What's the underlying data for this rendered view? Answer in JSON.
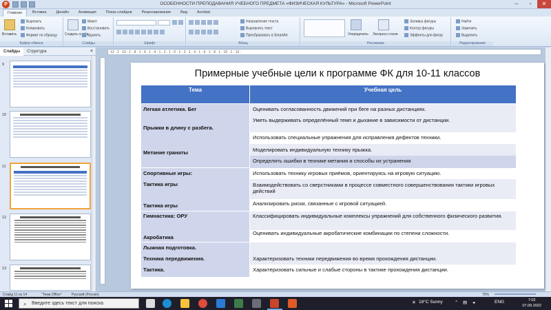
{
  "window": {
    "title": "ОСОБЕННОСТИ ПРЕПОДАВАНИЯ УЧЕБНОГО ПРЕДМЕТА «ФИЗИЧЕСКАЯ КУЛЬТУРА» - Microsoft PowerPoint"
  },
  "ribbon": {
    "tabs": [
      "Главная",
      "Вставка",
      "Дизайн",
      "Анимация",
      "Показ слайдов",
      "Рецензирование",
      "Вид",
      "Acrobat"
    ],
    "clipboard": {
      "paste": "Вставить",
      "cut": "Вырезать",
      "copy": "Копировать",
      "format_painter": "Формат по образцу",
      "label": "Буфер обмена"
    },
    "slides": {
      "new_slide": "Создать слайд",
      "layout": "Макет",
      "reset": "Восстановить",
      "delete": "Удалить",
      "label": "Слайды"
    },
    "font": {
      "label": "Шрифт"
    },
    "paragraph": {
      "direction": "Направление текста",
      "align": "Выровнять текст",
      "smartart": "Преобразовать в SmartArt",
      "label": "Абзац"
    },
    "drawing": {
      "arrange": "Упорядочить",
      "quick_styles": "Экспресс-стили",
      "fill": "Заливка фигуры",
      "outline": "Контур фигуры",
      "effects": "Эффекты для фигур",
      "label": "Рисование"
    },
    "editing": {
      "find": "Найти",
      "replace": "Заменить",
      "select": "Выделить",
      "label": "Редактирование"
    }
  },
  "left_panel": {
    "tab_slides": "Слайды",
    "tab_outline": "Структура",
    "thumb_numbers": [
      "9",
      "10",
      "11",
      "12",
      "13"
    ]
  },
  "ruler": "· 12 · 1 · 10 · 1 · 8 · 1 · 6 · 1 · 4 · 1 · 2 · 1 · 0 · 1 · 2 · 1 · 4 · 1 · 6 · 1 · 8 · 1 · 10 · 1 · 12 ·",
  "slide": {
    "title": "Примерные учебные цели к программе ФК для 10-11 классов",
    "headers": {
      "topic": "Тема",
      "goal": "Учебная цель"
    },
    "rows": {
      "r1_topic": "Легкая атлетика. Бег",
      "r1_goal": "Оценивать согласованность движений при беге на разных дистанциях.",
      "r2_goal": "Уметь выдерживать определённый темп и дыхание в зависимости от дистанции.",
      "r3_topic": "Прыжки в длину с разбега.",
      "r3_goal": "Использовать специальные упражнения для исправления дефектов техники.",
      "r4_goal": "Моделировать индивидуальную технику прыжка.",
      "r5_topic": "Метание гранаты",
      "r5_goal": "Определять ошибки в технике метания и способы их устранения",
      "r6_topic": "Спортивные игры:",
      "r6_goal": "Использовать технику игровых приёмов, ориентируясь на игровую ситуацию.",
      "r7_topic": "Тактика игры",
      "r7_goal": "Взаимодействовать со сверстниками в процессе совместного совершенствования тактики игровых действий",
      "r8_goal": "Анализировать риски, связанные с игровой ситуацией.",
      "r9_topic": "Гимнастика: ОРУ",
      "r9_goal": "Классифицировать индивидуальные комплексы упражнений для собственного физического развития.",
      "r10_topic": "Акробатика",
      "r10_goal": "Оценивать индивидуальные акробатические комбинации по степени сложности.",
      "r11_topic": "Лыжная подготовка.",
      "r12_topic": "Техника передвижения.",
      "r12_goal": "Характеризовать техники передвижения во время прохождения дистанции.",
      "r13_topic": "Тактика.",
      "r13_goal": "Характеризовать сильные и слабые стороны в тактике прохождения дистанции."
    }
  },
  "status": {
    "slide_info": "Слайд 11 из 14",
    "theme": "\"Тема Office\"",
    "language": "Русский (Россия)",
    "zoom": "75%"
  },
  "taskbar": {
    "search_placeholder": "Введите здесь текст для поиска",
    "weather": "18°C Sunny",
    "lang": "ENG",
    "time": "7:02",
    "date": "07.09.2022"
  },
  "colors": {
    "header_blue": "#4472c4",
    "topic_cell": "#cfd5ea",
    "goal_cell": "#e9ebf5"
  }
}
